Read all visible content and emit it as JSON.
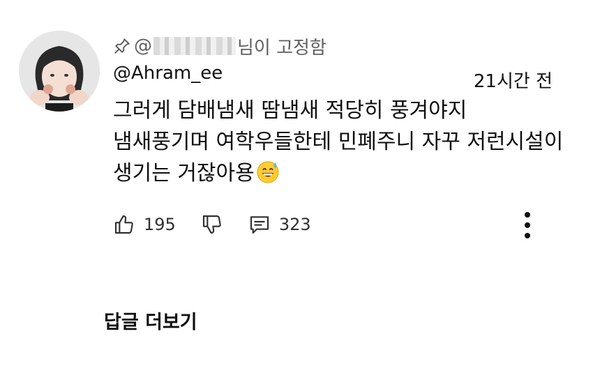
{
  "comment": {
    "pinned_prefix": "@",
    "pinned_suffix": "님이 고정함",
    "author": "@Ahram_ee",
    "time": "21시간 전",
    "text": "그러게 담배냄새 땀냄새 적당히 풍겨야지 냄새풍기며 여학우들한테 민폐주니 자꾸 저런시설이 생기는 거잖아용",
    "emoji_icon": "grinning-sweat-emoji",
    "likes": "195",
    "replies": "323"
  },
  "footer": {
    "more_replies_label": "답글 더보기"
  },
  "colors": {
    "text_primary": "#0f0f0f",
    "text_secondary": "#606060",
    "background": "#ffffff"
  }
}
